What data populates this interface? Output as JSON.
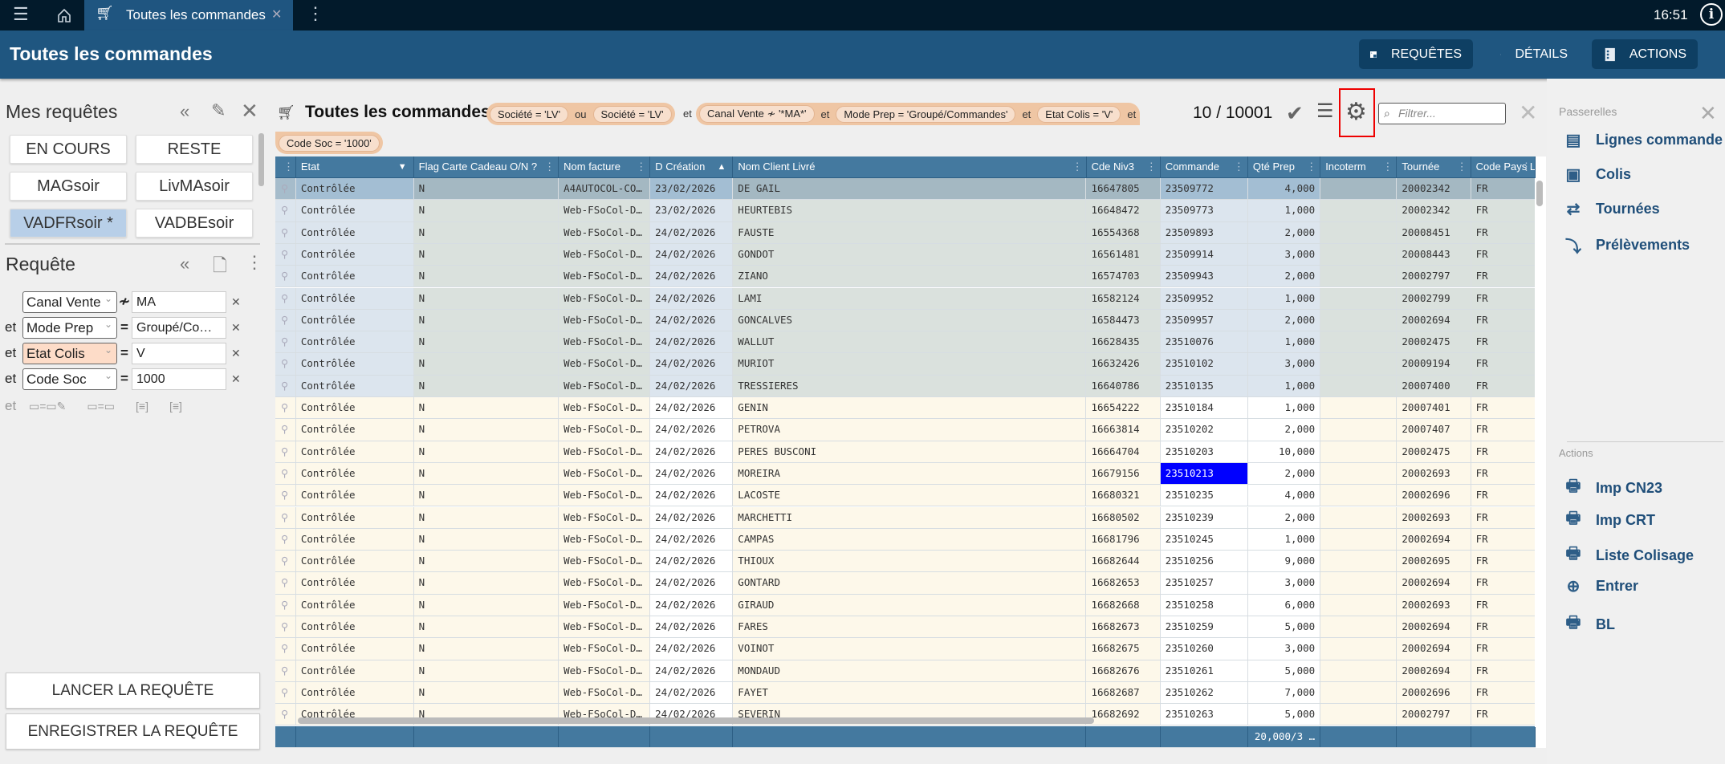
{
  "topbar": {
    "tab_title": "Toutes les commandes",
    "time": "16:51",
    "info": "i"
  },
  "header": {
    "title": "Toutes les commandes",
    "buttons": [
      "REQUÊTES",
      "DÉTAILS",
      "ACTIONS"
    ]
  },
  "left": {
    "mes_requetes": "Mes requêtes",
    "saved": [
      "EN COURS",
      "RESTE",
      "MAGsoir",
      "LivMAsoir",
      "VADFRsoir *",
      "VADBEsoir"
    ],
    "requete": "Requête",
    "criteria": [
      {
        "conj": "",
        "field": "Canal Vente",
        "op": "≁",
        "value": "MA"
      },
      {
        "conj": "et",
        "field": "Mode Prep",
        "op": "=",
        "value": "Groupé/Co…"
      },
      {
        "conj": "et",
        "field": "Etat Colis",
        "op": "=",
        "value": "V"
      },
      {
        "conj": "et",
        "field": "Code Soc",
        "op": "=",
        "value": "1000"
      }
    ],
    "add_conj": "et",
    "launch": "LANCER LA REQUÊTE",
    "save": "ENREGISTRER LA REQUÊTE"
  },
  "query": {
    "title": "Toutes les commandes :",
    "chips": [
      "Société = 'LV'",
      "Société = 'LV'",
      "Canal Vente ≁ '*MA*'",
      "Mode Prep = 'Groupé/Commandes'",
      "Etat Colis = 'V'",
      "Code Soc = '1000'"
    ],
    "ou": "ou",
    "et": "et",
    "count": "10 / 10001",
    "filter_placeholder": "Filtrer..."
  },
  "table": {
    "columns": [
      "Etat",
      "Flag Carte Cadeau O/N ?",
      "Nom facture",
      "D Création",
      "Nom Client Livré",
      "Cde Niv3",
      "Commande",
      "Qté Prep",
      "Incoterm",
      "Tournée",
      "Code Pays Li"
    ],
    "rows": [
      [
        "Contrôlée",
        "N",
        "A4AUTOCOL-CO…",
        "23/02/2026",
        "DE GAIL",
        "16647805",
        "23509772",
        "4,000",
        "",
        "20002342",
        "FR"
      ],
      [
        "Contrôlée",
        "N",
        "Web-FSoCol-D…",
        "23/02/2026",
        "HEURTEBIS",
        "16648472",
        "23509773",
        "1,000",
        "",
        "20002342",
        "FR"
      ],
      [
        "Contrôlée",
        "N",
        "Web-FSoCol-D…",
        "24/02/2026",
        "FAUSTE",
        "16554368",
        "23509893",
        "2,000",
        "",
        "20008451",
        "FR"
      ],
      [
        "Contrôlée",
        "N",
        "Web-FSoCol-D…",
        "24/02/2026",
        "GONDOT",
        "16561481",
        "23509914",
        "3,000",
        "",
        "20008443",
        "FR"
      ],
      [
        "Contrôlée",
        "N",
        "Web-FSoCol-D…",
        "24/02/2026",
        "ZIANO",
        "16574703",
        "23509943",
        "2,000",
        "",
        "20002797",
        "FR"
      ],
      [
        "Contrôlée",
        "N",
        "Web-FSoCol-D…",
        "24/02/2026",
        "LAMI",
        "16582124",
        "23509952",
        "1,000",
        "",
        "20002799",
        "FR"
      ],
      [
        "Contrôlée",
        "N",
        "Web-FSoCol-D…",
        "24/02/2026",
        "GONCALVES",
        "16584473",
        "23509957",
        "2,000",
        "",
        "20002694",
        "FR"
      ],
      [
        "Contrôlée",
        "N",
        "Web-FSoCol-D…",
        "24/02/2026",
        "WALLUT",
        "16628435",
        "23510076",
        "1,000",
        "",
        "20002475",
        "FR"
      ],
      [
        "Contrôlée",
        "N",
        "Web-FSoCol-D…",
        "24/02/2026",
        "MURIOT",
        "16632426",
        "23510102",
        "3,000",
        "",
        "20009194",
        "FR"
      ],
      [
        "Contrôlée",
        "N",
        "Web-FSoCol-D…",
        "24/02/2026",
        "TRESSIERES",
        "16640786",
        "23510135",
        "1,000",
        "",
        "20007400",
        "FR"
      ],
      [
        "Contrôlée",
        "N",
        "Web-FSoCol-D…",
        "24/02/2026",
        "GENIN",
        "16654222",
        "23510184",
        "1,000",
        "",
        "20007401",
        "FR"
      ],
      [
        "Contrôlée",
        "N",
        "Web-FSoCol-D…",
        "24/02/2026",
        "PETROVA",
        "16663814",
        "23510202",
        "2,000",
        "",
        "20007407",
        "FR"
      ],
      [
        "Contrôlée",
        "N",
        "Web-FSoCol-D…",
        "24/02/2026",
        "PERES BUSCONI",
        "16664704",
        "23510203",
        "10,000",
        "",
        "20002475",
        "FR"
      ],
      [
        "Contrôlée",
        "N",
        "Web-FSoCol-D…",
        "24/02/2026",
        "MOREIRA",
        "16679156",
        "23510213",
        "2,000",
        "",
        "20002693",
        "FR"
      ],
      [
        "Contrôlée",
        "N",
        "Web-FSoCol-D…",
        "24/02/2026",
        "LACOSTE",
        "16680321",
        "23510235",
        "4,000",
        "",
        "20002696",
        "FR"
      ],
      [
        "Contrôlée",
        "N",
        "Web-FSoCol-D…",
        "24/02/2026",
        "MARCHETTI",
        "16680502",
        "23510239",
        "2,000",
        "",
        "20002693",
        "FR"
      ],
      [
        "Contrôlée",
        "N",
        "Web-FSoCol-D…",
        "24/02/2026",
        "CAMPAS",
        "16681796",
        "23510245",
        "1,000",
        "",
        "20002694",
        "FR"
      ],
      [
        "Contrôlée",
        "N",
        "Web-FSoCol-D…",
        "24/02/2026",
        "THIOUX",
        "16682644",
        "23510256",
        "9,000",
        "",
        "20002695",
        "FR"
      ],
      [
        "Contrôlée",
        "N",
        "Web-FSoCol-D…",
        "24/02/2026",
        "GONTARD",
        "16682653",
        "23510257",
        "3,000",
        "",
        "20002694",
        "FR"
      ],
      [
        "Contrôlée",
        "N",
        "Web-FSoCol-D…",
        "24/02/2026",
        "GIRAUD",
        "16682668",
        "23510258",
        "6,000",
        "",
        "20002693",
        "FR"
      ],
      [
        "Contrôlée",
        "N",
        "Web-FSoCol-D…",
        "24/02/2026",
        "FARES",
        "16682673",
        "23510259",
        "5,000",
        "",
        "20002694",
        "FR"
      ],
      [
        "Contrôlée",
        "N",
        "Web-FSoCol-D…",
        "24/02/2026",
        "VOINOT",
        "16682675",
        "23510260",
        "3,000",
        "",
        "20002694",
        "FR"
      ],
      [
        "Contrôlée",
        "N",
        "Web-FSoCol-D…",
        "24/02/2026",
        "MONDAUD",
        "16682676",
        "23510261",
        "5,000",
        "",
        "20002694",
        "FR"
      ],
      [
        "Contrôlée",
        "N",
        "Web-FSoCol-D…",
        "24/02/2026",
        "FAYET",
        "16682687",
        "23510262",
        "7,000",
        "",
        "20002696",
        "FR"
      ],
      [
        "Contrôlée",
        "N",
        "Web-FSoCol-D…",
        "24/02/2026",
        "SEVERIN",
        "16682692",
        "23510263",
        "5,000",
        "",
        "20002797",
        "FR"
      ]
    ],
    "footer_qte": "20,000/3 …"
  },
  "right": {
    "passerelles": "Passerelles",
    "links": [
      "Lignes commande",
      "Colis",
      "Tournées",
      "Prélèvements"
    ],
    "actions_title": "Actions",
    "actions": [
      "Imp CN23",
      "Imp CRT",
      "Liste Colisage",
      "Entrer",
      "BL"
    ]
  },
  "colors": {
    "header": "#1f5680",
    "topbar": "#021a2b",
    "table_header": "#44799f",
    "selected_cell": "#0000ff",
    "chip_group": "#efc6a4"
  }
}
